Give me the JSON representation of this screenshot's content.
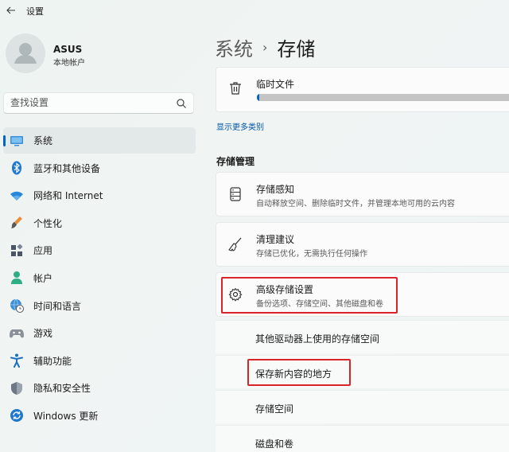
{
  "window": {
    "title": "设置"
  },
  "user": {
    "name": "ASUS",
    "account_type": "本地帐户"
  },
  "search": {
    "placeholder": "查找设置"
  },
  "nav": {
    "items": [
      {
        "label": "系统",
        "icon": "monitor-icon",
        "active": true
      },
      {
        "label": "蓝牙和其他设备",
        "icon": "bluetooth-icon"
      },
      {
        "label": "网络和 Internet",
        "icon": "wifi-icon"
      },
      {
        "label": "个性化",
        "icon": "brush-icon"
      },
      {
        "label": "应用",
        "icon": "apps-icon"
      },
      {
        "label": "帐户",
        "icon": "person-icon"
      },
      {
        "label": "时间和语言",
        "icon": "globe-clock-icon"
      },
      {
        "label": "游戏",
        "icon": "gamepad-icon"
      },
      {
        "label": "辅助功能",
        "icon": "accessibility-icon"
      },
      {
        "label": "隐私和安全性",
        "icon": "shield-icon"
      },
      {
        "label": "Windows 更新",
        "icon": "update-icon"
      }
    ]
  },
  "breadcrumb": {
    "parent": "系统",
    "separator": "›",
    "current": "存储"
  },
  "temp_files": {
    "label": "临时文件",
    "icon": "trash-icon",
    "usage_fraction": 0.01
  },
  "more_categories_link": "显示更多类别",
  "storage_management": {
    "title": "存储管理",
    "items": [
      {
        "title": "存储感知",
        "description": "自动释放空间、删除临时文件，并管理本地可用的云内容",
        "icon": "storage-drive-icon"
      },
      {
        "title": "清理建议",
        "description": "存储已优化，无需执行任何操作",
        "icon": "broom-icon"
      },
      {
        "title": "高级存储设置",
        "description": "备份选项、存储空间、其他磁盘和卷",
        "icon": "gear-icon",
        "highlighted": true
      }
    ],
    "advanced_sub_items": [
      {
        "label": "其他驱动器上使用的存储空间"
      },
      {
        "label": "保存新内容的地方",
        "highlighted": true
      },
      {
        "label": "存储空间"
      },
      {
        "label": "磁盘和卷"
      }
    ]
  },
  "colors": {
    "accent": "#0067c0",
    "highlight_box": "#d9242a"
  }
}
